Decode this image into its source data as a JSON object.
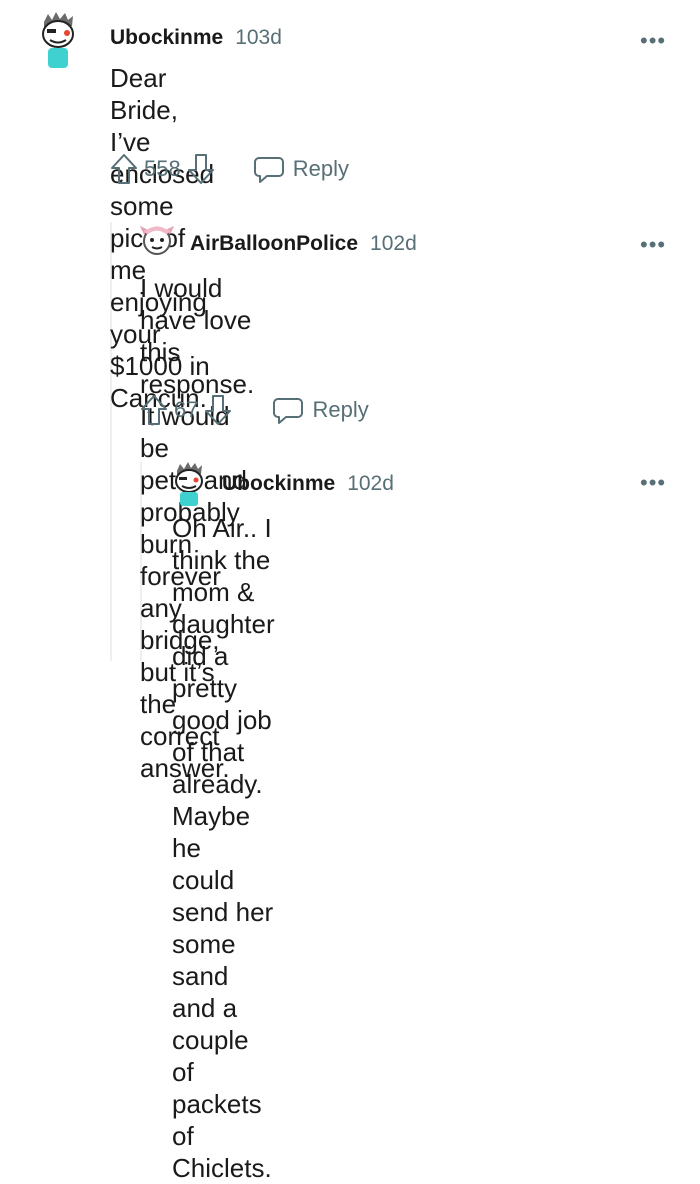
{
  "comments": [
    {
      "username": "Ubockinme",
      "age": "103d",
      "body_lines": [
        "Dear Bride, I’ve enclosed some pics of me",
        "enjoying your $1000 in Cancun."
      ],
      "score": "558",
      "reply_label": "Reply",
      "more_label": "•••"
    },
    {
      "username": "AirBalloonPolice",
      "age": "102d",
      "body_lines": [
        "I would have love this response. It would be",
        "petty and probably burn forever any bridge,",
        "but it’s the correct answer."
      ],
      "score": "67",
      "reply_label": "Reply",
      "more_label": "•••"
    },
    {
      "username": "Ubockinme",
      "age": "102d",
      "body_lines": [
        "Oh Air.. I think the mom & daughter did a",
        "pretty good job of that already. Maybe he",
        "could send her some sand and a couple",
        "of packets of Chiclets."
      ],
      "more_label": "•••"
    }
  ],
  "colors": {
    "text": "#1a1a1b",
    "meta": "#576f76",
    "thread_line": "#edeff1"
  },
  "icons": [
    "upvote-icon",
    "downvote-icon",
    "reply-icon",
    "more-options-icon",
    "user-avatar"
  ]
}
